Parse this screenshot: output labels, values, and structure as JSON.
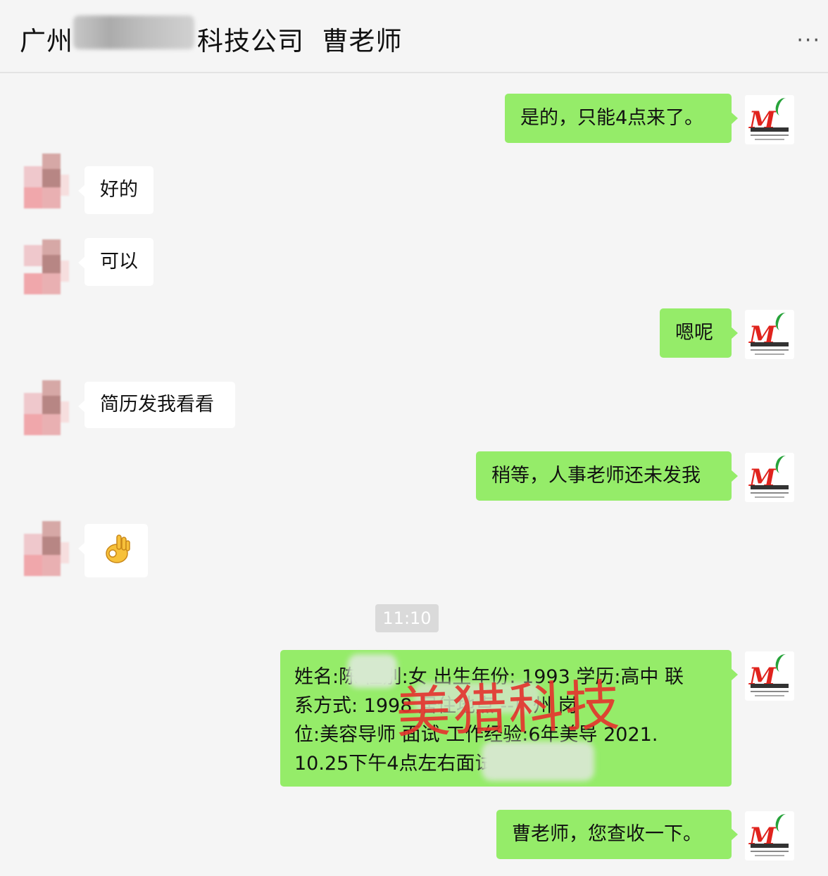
{
  "header": {
    "title_prefix": "广州",
    "title_suffix": "科技公司  曹老师",
    "more_icon": "more-dots-icon"
  },
  "window_controls": [
    "minimize-icon",
    "maximize-icon",
    "close-icon"
  ],
  "messages": [
    {
      "side": "right",
      "text": "是的，只能4点来了。"
    },
    {
      "side": "left",
      "text": "好的"
    },
    {
      "side": "left",
      "text": "可以"
    },
    {
      "side": "right",
      "text": "嗯呢"
    },
    {
      "side": "left",
      "text": "简历发我看看"
    },
    {
      "side": "right",
      "text": "稍等，人事老师还未发我"
    },
    {
      "side": "left",
      "emoji": "ok-hand-emoji"
    },
    {
      "side": "right",
      "resume_lines": [
        "姓名:陈  性别:女 出生年份: 1993 学历:高中 联",
        "系方式: 1998     居住地点       --广州 岗",
        "位:美容导师      面试   工作经验:6年美导 2021.",
        "10.25下午4点左右面试         美容导师"
      ]
    },
    {
      "side": "right",
      "text": "曹老师，您查收一下。"
    }
  ],
  "timestamp": "11:10",
  "watermark": "美猎科技",
  "colors": {
    "sent_bubble": "#95ec69",
    "received_bubble": "#ffffff",
    "background": "#f5f5f5",
    "watermark": "#e5322d"
  }
}
